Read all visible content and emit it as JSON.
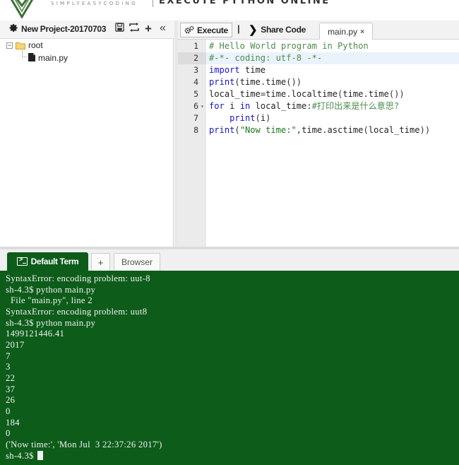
{
  "header": {
    "logo_text": "SIMPLYEASYCODING",
    "app_title": "EXECUTE PYTHON ONLINE"
  },
  "project_pane": {
    "project_name": "New Project-20170703",
    "toolbar_icons": [
      "gear-icon",
      "save-icon",
      "refresh-icon",
      "add-icon",
      "collapse-icon"
    ],
    "tree": {
      "root_label": "root",
      "root_expander": "−",
      "files": [
        {
          "label": "main.py"
        }
      ]
    }
  },
  "editor_toolbar": {
    "execute_label": "Execute",
    "separator": "|",
    "share_label": "Share Code",
    "active_file_tab": "main.py",
    "close_glyph": "×"
  },
  "editor": {
    "active_line": 2,
    "lines": [
      {
        "num": "1",
        "text": "# Hello World program in Python"
      },
      {
        "num": "2",
        "text": "#-*- coding: utf-8 -*-"
      },
      {
        "num": "3",
        "text": "import time"
      },
      {
        "num": "4",
        "text": "print(time.time())"
      },
      {
        "num": "5",
        "text": "local_time=time.localtime(time.time())"
      },
      {
        "num": "6",
        "text": "for i in local_time:#打印出来是什么意思?"
      },
      {
        "num": "7",
        "text": "    print(i)"
      },
      {
        "num": "8",
        "text": "print(\"Now time:\",time.asctime(local_time))"
      }
    ]
  },
  "terminal_tabs": {
    "default_label": "Default Term",
    "add_label": "+",
    "browser_label": "Browser"
  },
  "terminal": {
    "lines": [
      "SyntaxError: encoding problem: uut-8",
      "sh-4.3$ python main.py",
      "  File \"main.py\", line 2",
      "SyntaxError: encoding problem: uut8",
      "sh-4.3$ python main.py",
      "1499121446.41",
      "2017",
      "7",
      "3",
      "22",
      "37",
      "26",
      "0",
      "184",
      "0",
      "('Now time:', 'Mon Jul  3 22:37:26 2017')"
    ],
    "prompt": "sh-4.3$ "
  },
  "colors": {
    "terminal_bg": "#0d5c1a",
    "keyword": "#1515c8",
    "comment": "#4d8c4d",
    "string": "#1a7a1a"
  }
}
